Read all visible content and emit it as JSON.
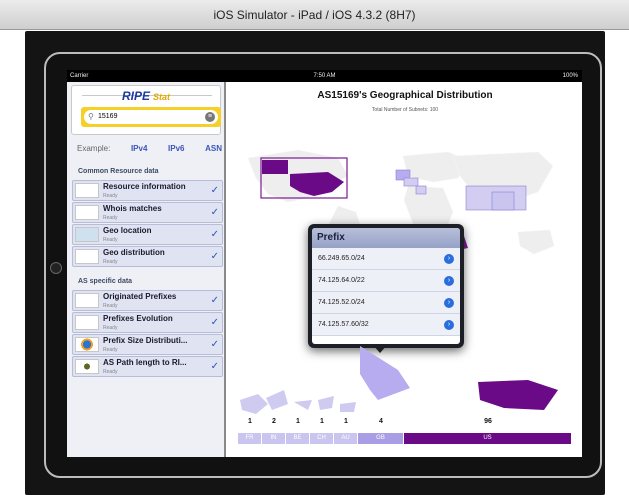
{
  "window": {
    "title": "iOS Simulator - iPad / iOS 4.3.2 (8H7)"
  },
  "statusbar": {
    "carrier": "Carrier",
    "time": "7:50 AM",
    "battery": "100%"
  },
  "logo": {
    "brand": "RIPE",
    "sub": "Stat"
  },
  "search": {
    "value": "15169"
  },
  "examples": {
    "label": "Example:",
    "links": [
      "IPv4",
      "IPv6",
      "ASN"
    ]
  },
  "sections": {
    "common": "Common Resource data",
    "as_specific": "AS specific data"
  },
  "common_items": [
    {
      "label": "Resource information",
      "status": "Ready"
    },
    {
      "label": "Whois matches",
      "status": "Ready"
    },
    {
      "label": "Geo location",
      "status": "Ready"
    },
    {
      "label": "Geo distribution",
      "status": "Ready"
    }
  ],
  "as_items": [
    {
      "label": "Originated Prefixes",
      "status": "Ready"
    },
    {
      "label": "Prefixes Evolution",
      "status": "Ready"
    },
    {
      "label": "Prefix Size Distributi...",
      "status": "Ready"
    },
    {
      "label": "AS Path length to RI...",
      "status": "Ready"
    }
  ],
  "chart": {
    "title": "AS15169's Geographical Distribution",
    "subtitle": "Total Number of Subnets: 100"
  },
  "popover": {
    "title": "Prefix",
    "rows": [
      "66.249.65.0/24",
      "74.125.64.0/22",
      "74.125.52.0/24",
      "74.125.57.60/32"
    ]
  },
  "colors": {
    "us": "#6b0a86",
    "gb": "#a99ee6",
    "small": "#c9c5ef",
    "accent": "#2a56b8"
  },
  "chart_data": {
    "type": "bar",
    "categories": [
      "FR",
      "IN",
      "BE",
      "CH",
      "AU",
      "GB",
      "US"
    ],
    "values": [
      1,
      2,
      1,
      1,
      1,
      4,
      96
    ]
  }
}
